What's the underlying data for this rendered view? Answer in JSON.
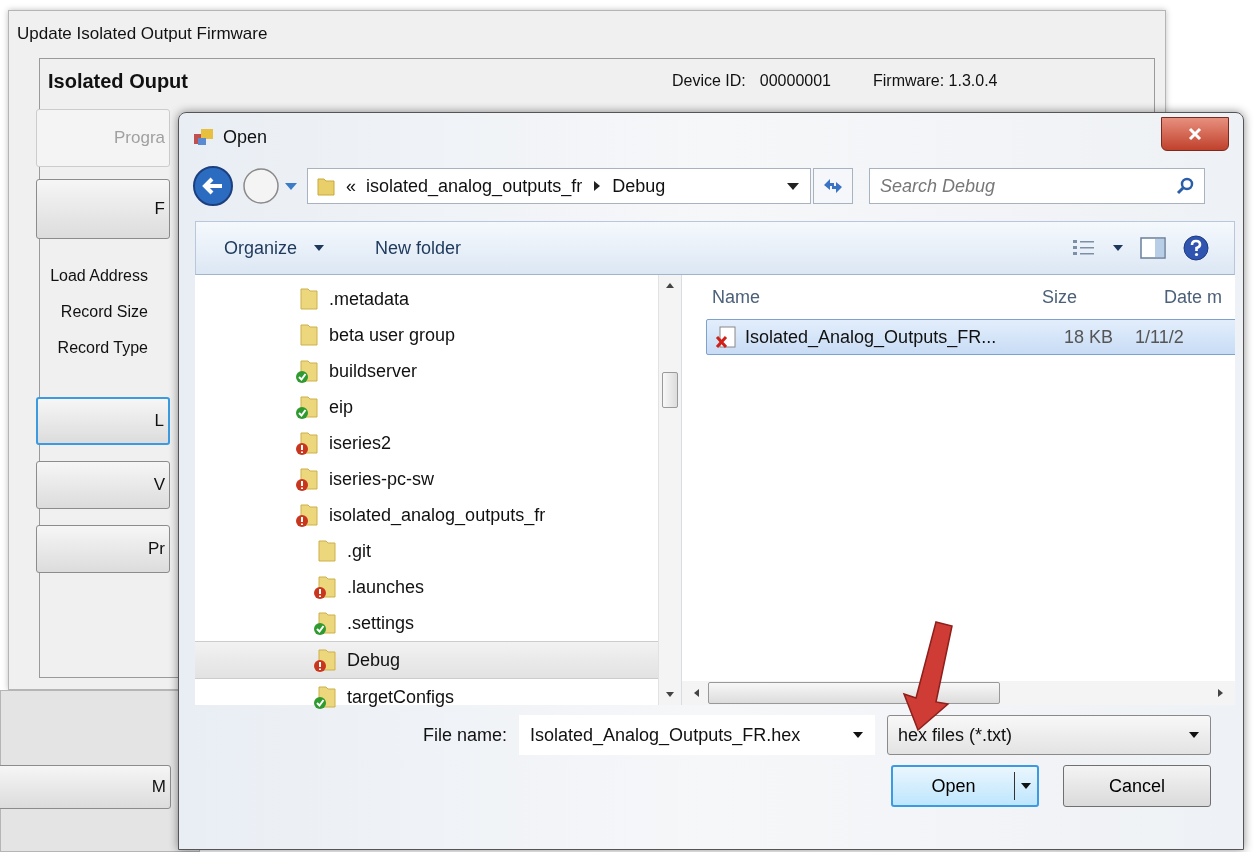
{
  "main_window": {
    "title": "Update Isolated Output Firmware",
    "heading": "Isolated Ouput",
    "device_id_label": "Device ID:",
    "device_id": "00000001",
    "firmware": "Firmware: 1.3.0.4",
    "buttons": [
      {
        "label": "Progra",
        "disabled": true,
        "focused": false
      },
      {
        "label": "F",
        "disabled": false,
        "focused": false
      }
    ],
    "fields": [
      "Load Address",
      "Record Size",
      "Record Type"
    ],
    "lower_buttons": [
      {
        "label": "L",
        "disabled": false,
        "focused": true
      },
      {
        "label": "V",
        "disabled": false,
        "focused": false
      },
      {
        "label": "Pr",
        "disabled": false,
        "focused": false
      }
    ]
  },
  "background_window": {
    "button": "M"
  },
  "dialog": {
    "title": "Open",
    "address": {
      "overflow": "«",
      "parent": "isolated_analog_outputs_fr",
      "current": "Debug"
    },
    "search": {
      "placeholder": "Search Debug"
    },
    "toolbar": {
      "organize": "Organize",
      "new_folder": "New folder"
    },
    "tree": [
      {
        "label": ".metadata",
        "kind": "folder",
        "selected": false
      },
      {
        "label": "beta user group",
        "kind": "folder",
        "selected": false
      },
      {
        "label": "buildserver",
        "kind": "ok",
        "selected": false
      },
      {
        "label": "eip",
        "kind": "ok",
        "selected": false
      },
      {
        "label": "iseries2",
        "kind": "error",
        "selected": false
      },
      {
        "label": "iseries-pc-sw",
        "kind": "error",
        "selected": false
      },
      {
        "label": "isolated_analog_outputs_fr",
        "kind": "error",
        "selected": false,
        "children": [
          {
            "label": ".git",
            "kind": "folder",
            "selected": false
          },
          {
            "label": ".launches",
            "kind": "error",
            "selected": false
          },
          {
            "label": ".settings",
            "kind": "ok",
            "selected": false
          },
          {
            "label": "Debug",
            "kind": "error",
            "selected": true
          },
          {
            "label": "targetConfigs",
            "kind": "ok",
            "selected": false
          }
        ]
      }
    ],
    "columns": [
      "Name",
      "Size",
      "Date m"
    ],
    "files": [
      {
        "name": "Isolated_Analog_Outputs_FR...",
        "size": "18 KB",
        "date": "1/11/2",
        "selected": true
      }
    ],
    "file_name_label": "File name:",
    "file_name": "Isolated_Analog_Outputs_FR.hex",
    "filter": "hex files (*.txt)",
    "open_button": "Open",
    "cancel_button": "Cancel"
  }
}
